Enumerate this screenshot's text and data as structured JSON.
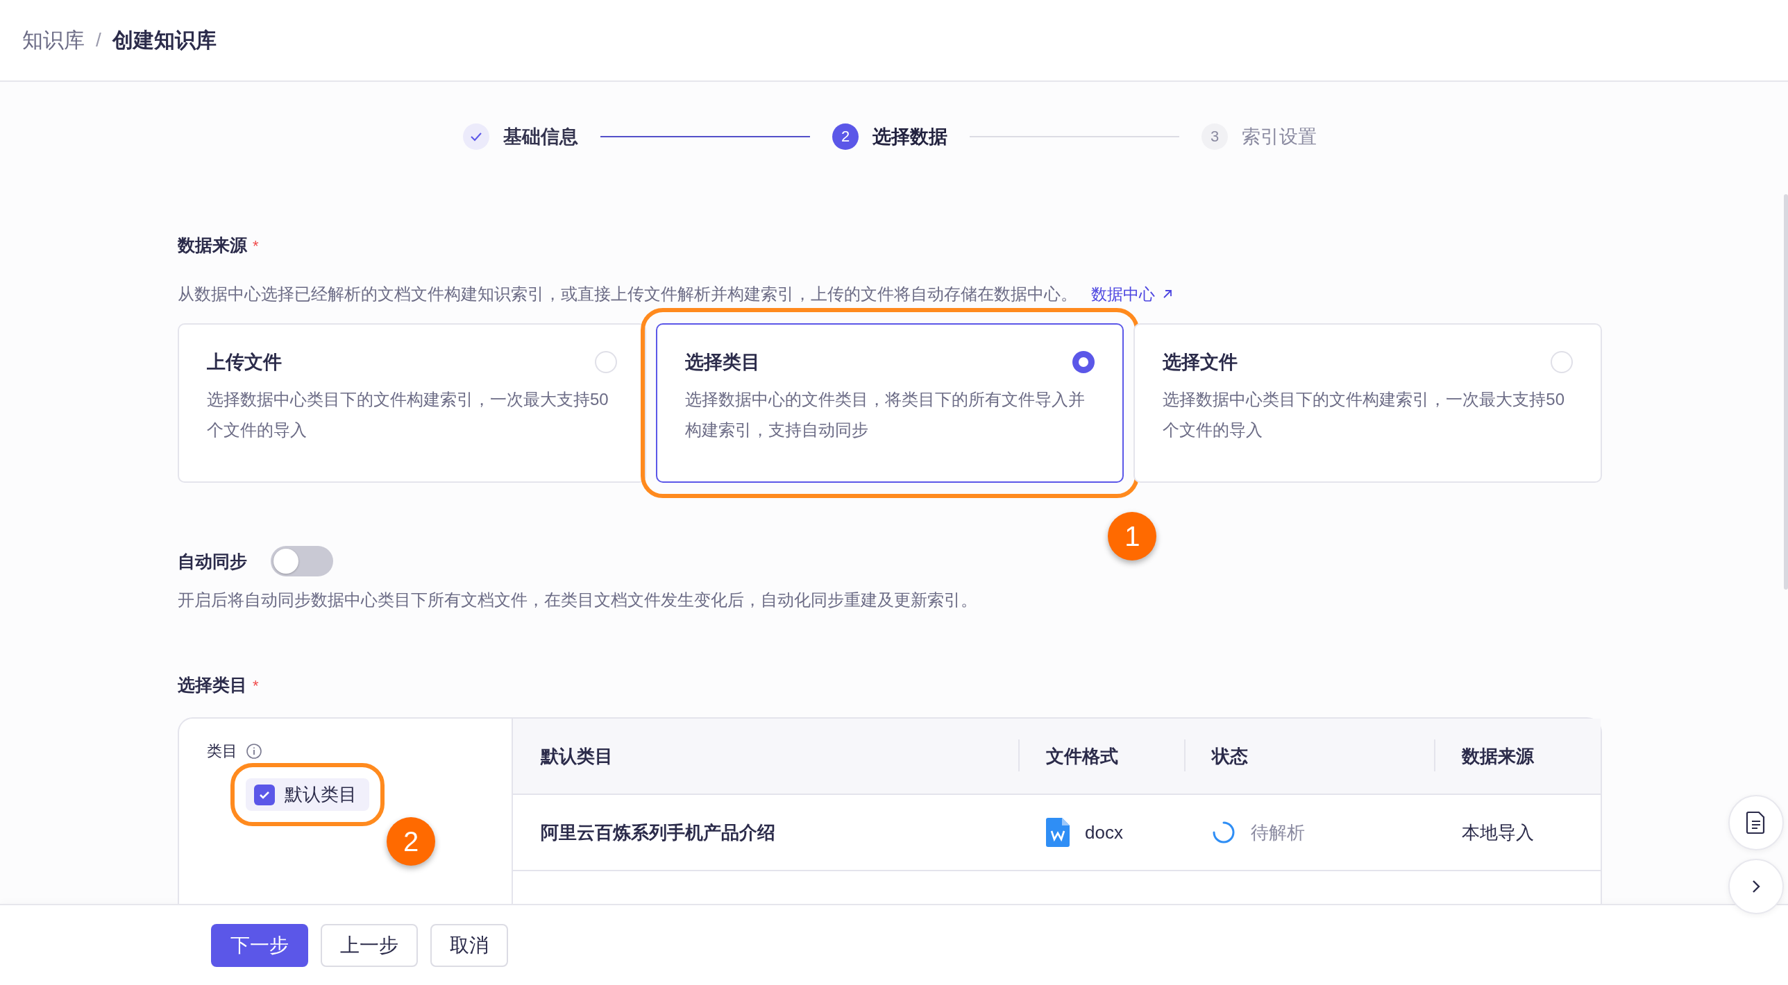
{
  "breadcrumb": {
    "items": [
      "知识库",
      "创建知识库"
    ],
    "separator": "/"
  },
  "steps": [
    {
      "label": "基础信息",
      "selected": false
    },
    {
      "number": "2",
      "label": "选择数据",
      "selected": true
    },
    {
      "number": "3",
      "label": "索引设置",
      "selected": false
    }
  ],
  "data_source": {
    "title": "数据来源",
    "required_mark": "*",
    "description": "从数据中心选择已经解析的文档文件构建知识索引，或直接上传文件解析并构建索引，上传的文件将自动存储在数据中心。",
    "link": "数据中心",
    "options": [
      {
        "title": "上传文件",
        "description": "选择数据中心类目下的文件构建索引，一次最大支持50个文件的导入",
        "selected": false
      },
      {
        "title": "选择类目",
        "description": "选择数据中心的文件类目，将类目下的所有文件导入并构建索引，支持自动同步",
        "selected": true,
        "annotation": "1"
      },
      {
        "title": "选择文件",
        "description": "选择数据中心类目下的文件构建索引，一次最大支持50个文件的导入",
        "selected": false
      }
    ]
  },
  "auto_sync": {
    "label": "自动同步",
    "on": false,
    "description": "开启后将自动同步数据中心类目下所有文档文件，在类目文档文件发生变化后，自动化同步重建及更新索引。"
  },
  "category_section": {
    "title": "选择类目",
    "required_mark": "*",
    "panel_label": "类目",
    "items": [
      {
        "label": "默认类目",
        "checked": true,
        "annotation": "2"
      }
    ],
    "table": {
      "columns": [
        "默认类目",
        "文件格式",
        "状态",
        "数据来源"
      ],
      "rows": [
        {
          "name": "阿里云百炼系列手机产品介绍",
          "format": "docx",
          "status": {
            "text": "待解析",
            "kind": "parsing"
          },
          "source": "本地导入"
        }
      ]
    }
  },
  "footer_buttons": [
    {
      "label": "下一步",
      "kind": "primary"
    },
    {
      "label": "上一步",
      "kind": "default"
    },
    {
      "label": "取消",
      "kind": "default"
    }
  ]
}
